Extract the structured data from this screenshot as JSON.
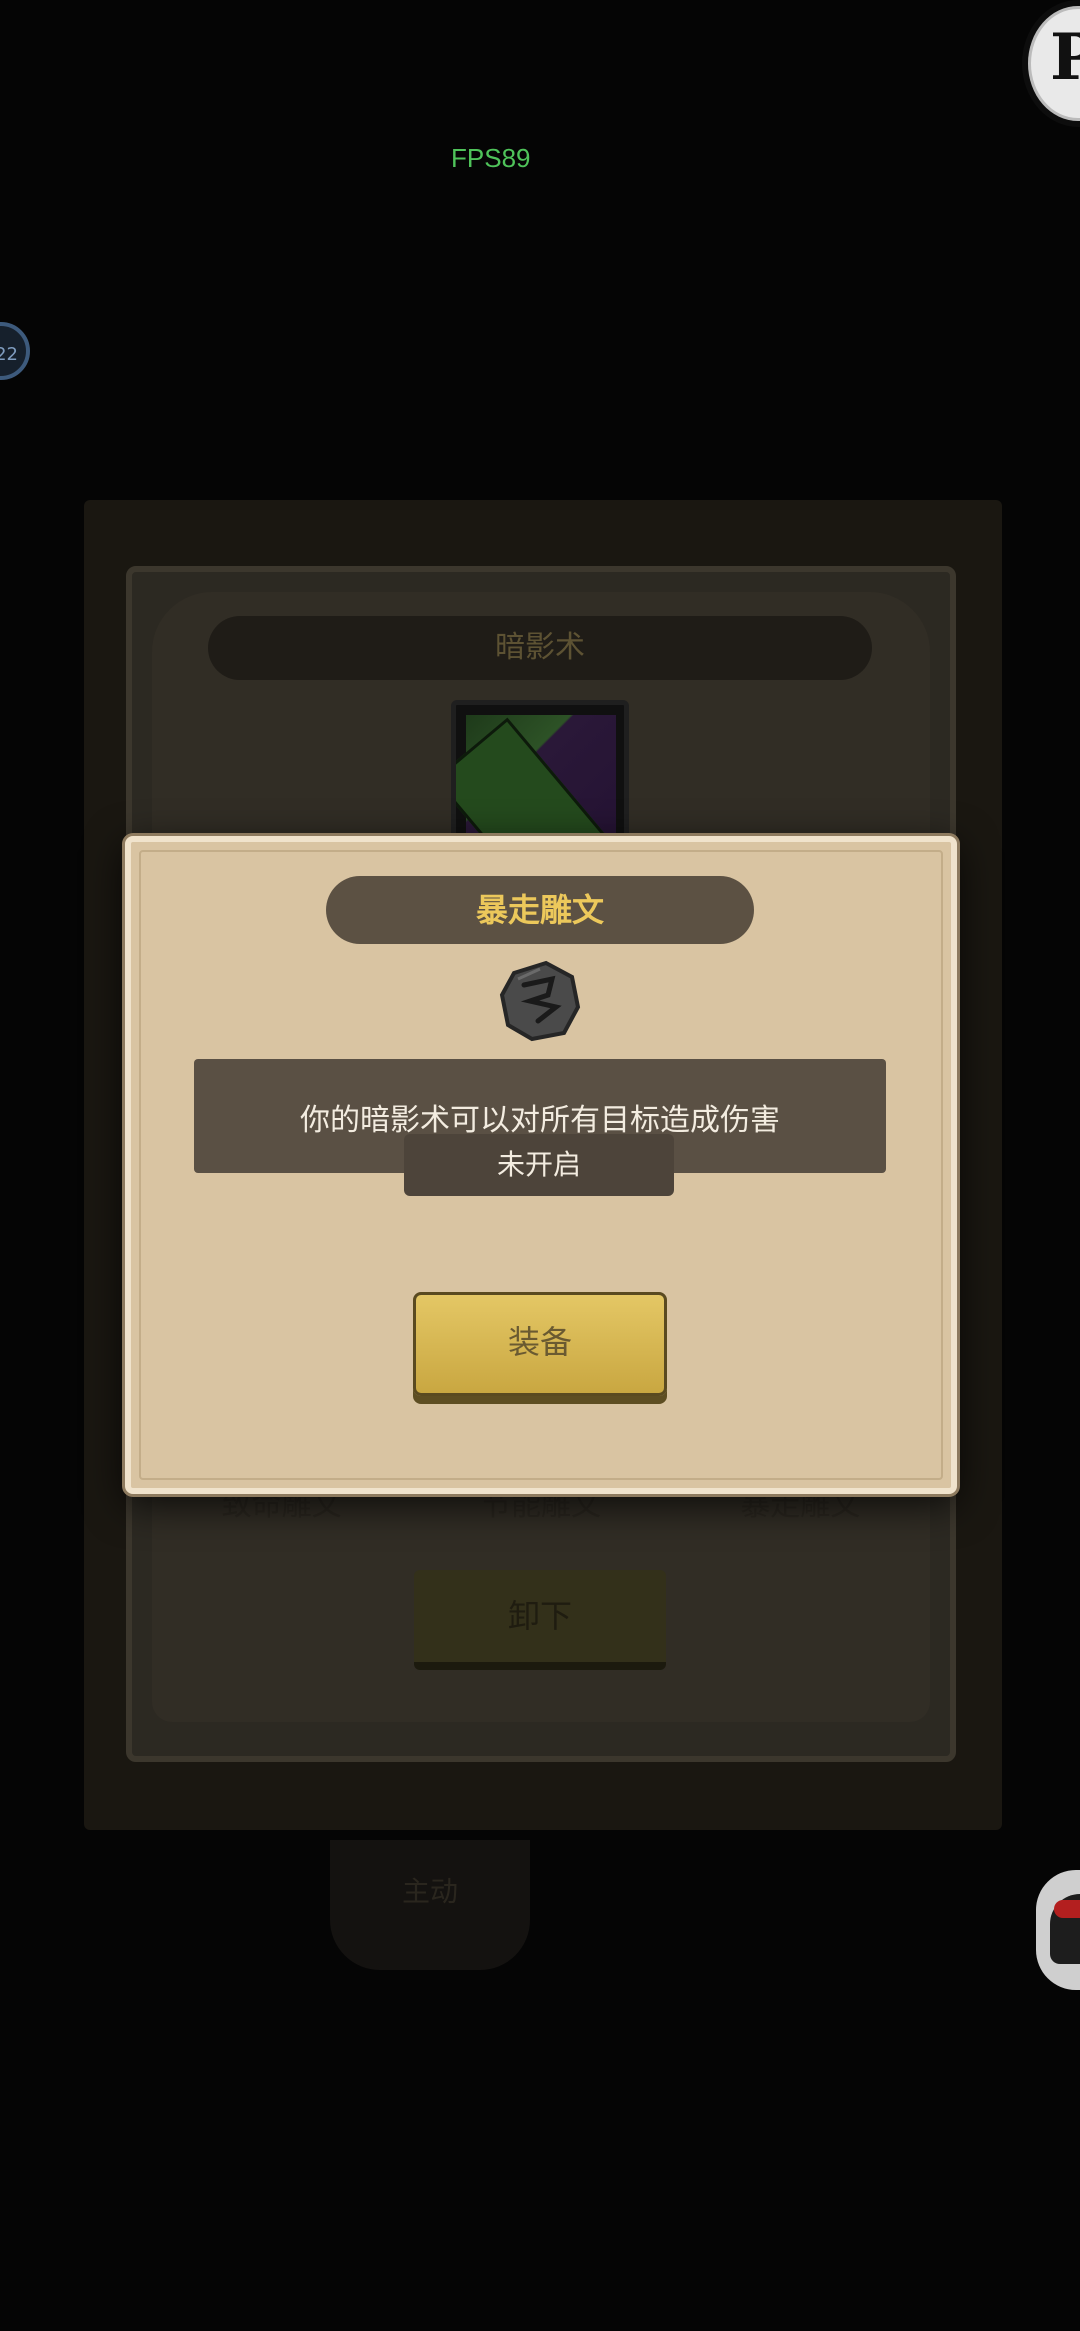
{
  "overlay": {
    "fps_text": "FPS89",
    "level_badge_text": "22"
  },
  "background_panel": {
    "skill_title": "暗影术",
    "rune_slot_labels": [
      "致命雕文",
      "节能雕文",
      "暴走雕文"
    ],
    "unload_button_label": "卸下",
    "active_tab_label": "主动"
  },
  "modal": {
    "title": "暴走雕文",
    "rune_icon": "rune-stone-icon",
    "description": "你的暗影术可以对所有目标造成伤害",
    "status": "未开启",
    "equip_button_label": "装备"
  },
  "colors": {
    "modal_bg": "#d9c4a2",
    "title_text": "#ecc85b",
    "button_gold": "#d4b24d",
    "fps_green": "#4fc35a"
  }
}
